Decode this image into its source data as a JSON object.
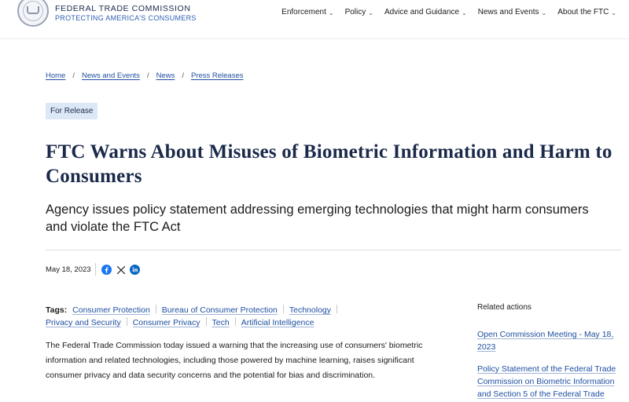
{
  "brand": {
    "title": "FEDERAL TRADE COMMISSION",
    "subtitle": "PROTECTING AMERICA'S CONSUMERS"
  },
  "nav": {
    "items": [
      {
        "label": "Enforcement"
      },
      {
        "label": "Policy"
      },
      {
        "label": "Advice and Guidance"
      },
      {
        "label": "News and Events"
      },
      {
        "label": "About the FTC"
      }
    ],
    "chevron": "⌄"
  },
  "breadcrumb": {
    "items": [
      "Home",
      "News and Events",
      "News",
      "Press Releases"
    ],
    "separator": "/"
  },
  "article": {
    "badge": "For Release",
    "title": "FTC Warns About Misuses of Biometric Information and Harm to Consumers",
    "subtitle": "Agency issues policy statement addressing emerging technologies that might harm consumers and violate the FTC Act",
    "date": "May 18, 2023",
    "share_icons": [
      "facebook-icon",
      "x-icon",
      "linkedin-icon"
    ],
    "tags_label": "Tags:",
    "tags": [
      "Consumer Protection",
      "Bureau of Consumer Protection",
      "Technology",
      "Privacy and Security",
      "Consumer Privacy",
      "Tech",
      "Artificial Intelligence"
    ],
    "body": "The Federal Trade Commission today issued a warning that the increasing use of consumers' biometric information and related technologies, including those powered by machine learning, raises significant consumer privacy and data security concerns and the potential for bias and discrimination."
  },
  "related": {
    "title": "Related actions",
    "links": [
      "Open Commission Meeting - May 18, 2023",
      "Policy Statement of the Federal Trade Commission on Biometric Information and Section 5 of the Federal Trade"
    ]
  },
  "colors": {
    "brand_navy": "#1b2a4a",
    "link_blue": "#1e4fa0",
    "badge_bg": "#dde8f6",
    "facebook_blue": "#1877f2",
    "linkedin_blue": "#0a66c2"
  }
}
